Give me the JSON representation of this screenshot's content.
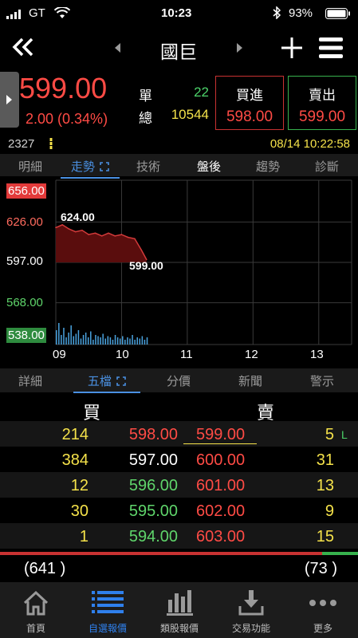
{
  "status_bar": {
    "carrier": "GT",
    "time": "10:23",
    "battery": "93%"
  },
  "nav": {
    "title": "國巨"
  },
  "quote": {
    "price": "599.00",
    "change": "2.00 (0.34%)",
    "single_label": "單",
    "single_value": "22",
    "total_label": "總",
    "total_value": "10544",
    "buy_label": "買進",
    "buy_price": "598.00",
    "sell_label": "賣出",
    "sell_price": "599.00",
    "code": "2327",
    "datetime": "08/14 10:22:58"
  },
  "top_tabs": [
    {
      "label": "明細"
    },
    {
      "label": "走勢"
    },
    {
      "label": "技術"
    },
    {
      "label": "盤後"
    },
    {
      "label": "趨勢"
    },
    {
      "label": "診斷"
    }
  ],
  "chart_data": {
    "type": "area",
    "y_ticks": [
      "656.00",
      "626.00",
      "597.00",
      "568.00",
      "538.00"
    ],
    "x_ticks": [
      "09",
      "10",
      "11",
      "12",
      "13"
    ],
    "ylim": [
      538,
      656
    ],
    "annotations": {
      "high": "624.00",
      "last": "599.00"
    },
    "x": [
      9.0,
      9.1,
      9.2,
      9.3,
      9.4,
      9.5,
      9.6,
      9.7,
      9.8,
      9.9,
      10.0,
      10.1,
      10.2,
      10.3,
      10.38
    ],
    "values": [
      622,
      624,
      621,
      619,
      620,
      617,
      618,
      616,
      618,
      616,
      617,
      615,
      614,
      606,
      599
    ],
    "colors": {
      "line": "#d23a3a",
      "fill": "#5a0d0d",
      "volume": "#4aa3df"
    }
  },
  "bottom_tabs": [
    {
      "label": "詳細"
    },
    {
      "label": "五檔"
    },
    {
      "label": "分價"
    },
    {
      "label": "新聞"
    },
    {
      "label": "警示"
    }
  ],
  "orderbook": {
    "buy_header": "買",
    "sell_header": "賣",
    "rows": [
      {
        "bid_qty": "214",
        "bid_price": "598.00",
        "ask_price": "599.00",
        "ask_qty": "5",
        "flag": "L"
      },
      {
        "bid_qty": "384",
        "bid_price": "597.00",
        "ask_price": "600.00",
        "ask_qty": "31",
        "flag": ""
      },
      {
        "bid_qty": "12",
        "bid_price": "596.00",
        "ask_price": "601.00",
        "ask_qty": "13",
        "flag": ""
      },
      {
        "bid_qty": "30",
        "bid_price": "595.00",
        "ask_price": "602.00",
        "ask_qty": "9",
        "flag": ""
      },
      {
        "bid_qty": "1",
        "bid_price": "594.00",
        "ask_price": "603.00",
        "ask_qty": "15",
        "flag": ""
      }
    ],
    "bid_total": "(641 )",
    "ask_total": "(73 )",
    "bid_share": 0.9
  },
  "tabbar": [
    {
      "label": "首頁",
      "icon": "home-icon"
    },
    {
      "label": "自選報價",
      "icon": "list-icon"
    },
    {
      "label": "類股報價",
      "icon": "bar-chart-icon"
    },
    {
      "label": "交易功能",
      "icon": "trade-icon"
    },
    {
      "label": "更多",
      "icon": "more-icon"
    }
  ]
}
